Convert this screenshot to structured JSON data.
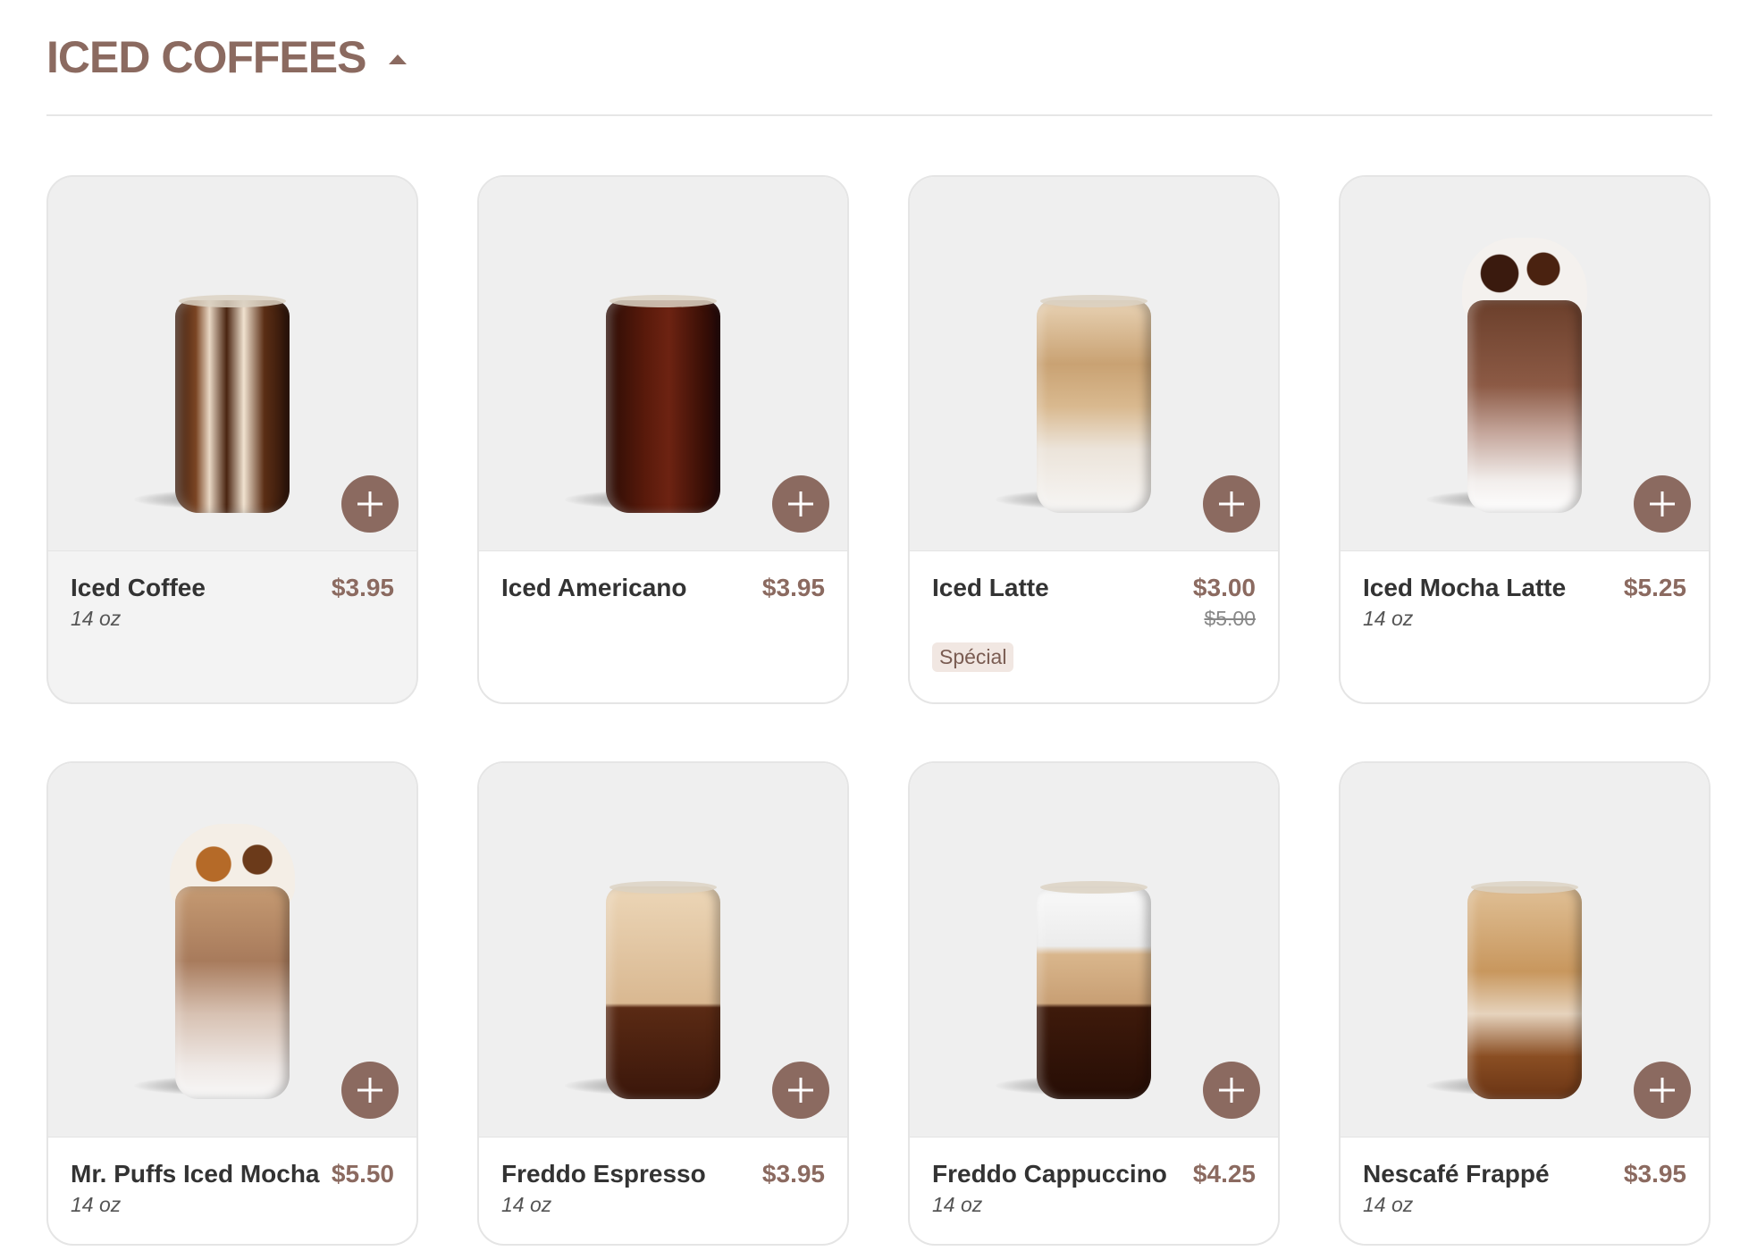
{
  "section": {
    "title": "ICED COFFEES"
  },
  "products": [
    {
      "name": "Iced Coffee",
      "price": "$3.95",
      "size": "14 oz",
      "image": "iced-coffee-glass"
    },
    {
      "name": "Iced Americano",
      "price": "$3.95",
      "image": "iced-americano-glass"
    },
    {
      "name": "Iced Latte",
      "price": "$3.00",
      "old_price": "$5.00",
      "badge": "Spécial",
      "image": "iced-latte-glass"
    },
    {
      "name": "Iced Mocha Latte",
      "price": "$5.25",
      "size": "14 oz",
      "image": "iced-mocha-latte-glass"
    },
    {
      "name": "Mr. Puffs Iced Mocha",
      "price": "$5.50",
      "size": "14 oz",
      "image": "mr-puffs-iced-mocha-glass"
    },
    {
      "name": "Freddo Espresso",
      "price": "$3.95",
      "size": "14 oz",
      "image": "freddo-espresso-glass"
    },
    {
      "name": "Freddo Cappuccino",
      "price": "$4.25",
      "size": "14 oz",
      "image": "freddo-cappuccino-glass"
    },
    {
      "name": "Nescafé Frappé",
      "price": "$3.95",
      "size": "14 oz",
      "image": "nescafe-frappe-glass"
    }
  ],
  "icons": {
    "collapse": "caret-up-icon",
    "add": "plus-icon"
  },
  "colors": {
    "accent": "#8b6a60",
    "card_border": "#e5e5e5",
    "image_bg": "#efefef",
    "badge_bg": "#f1e7e2"
  }
}
